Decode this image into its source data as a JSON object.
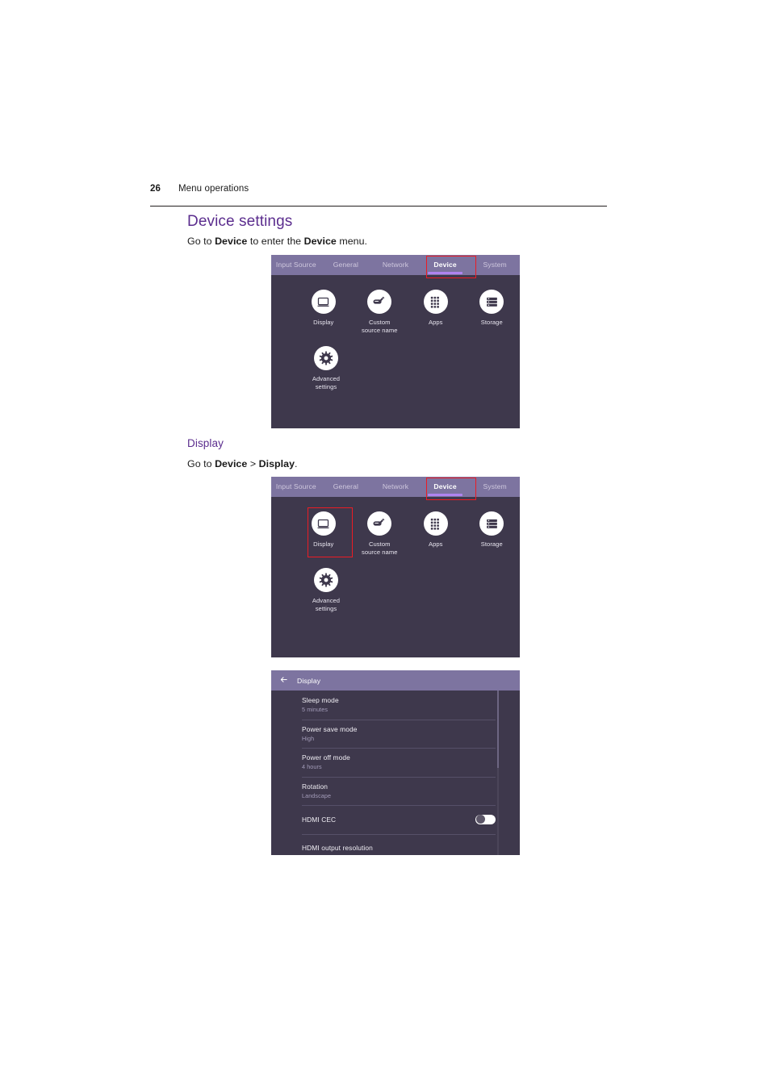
{
  "page": {
    "number": "26",
    "running_head": "Menu operations"
  },
  "section": {
    "heading": "Device settings",
    "intro_prefix": "Go to ",
    "intro_bold1": "Device",
    "intro_middle": " to enter the ",
    "intro_bold2": "Device",
    "intro_suffix": " menu."
  },
  "subsection": {
    "heading": "Display",
    "intro_prefix": "Go to ",
    "intro_bold1": "Device",
    "intro_middle": " > ",
    "intro_bold2": "Display",
    "intro_suffix": "."
  },
  "osd": {
    "tabs": [
      {
        "label": "Input Source",
        "active": false
      },
      {
        "label": "General",
        "active": false
      },
      {
        "label": "Network",
        "active": false
      },
      {
        "label": "Device",
        "active": true
      },
      {
        "label": "System",
        "active": false
      }
    ],
    "icons_row1": [
      {
        "label": "Display",
        "icon": "monitor-icon"
      },
      {
        "label": "Custom\nsource name",
        "icon": "rename-pencil-icon"
      },
      {
        "label": "Apps",
        "icon": "apps-grid-icon"
      },
      {
        "label": "Storage",
        "icon": "storage-list-icon"
      }
    ],
    "icons_row2": [
      {
        "label": "Advanced\nsettings",
        "icon": "gear-icon"
      }
    ]
  },
  "display_panel": {
    "back_icon": "back-arrow-icon",
    "title": "Display",
    "rows": [
      {
        "title": "Sleep mode",
        "sub": "5 minutes",
        "control": "none"
      },
      {
        "title": "Power save mode",
        "sub": "High",
        "control": "none"
      },
      {
        "title": "Power off mode",
        "sub": "4 hours",
        "control": "none"
      },
      {
        "title": "Rotation",
        "sub": "Landscape",
        "control": "none"
      },
      {
        "title": "HDMI CEC",
        "sub": "",
        "control": "toggle",
        "toggle_on": false
      },
      {
        "title": "HDMI output resolution",
        "sub": "",
        "control": "none"
      }
    ]
  },
  "colors": {
    "heading_purple": "#5B2D8E",
    "osd_tabbar": "#7D74A0",
    "osd_body": "#3E384C",
    "tab_underline": "#B084F0",
    "callout_red": "#EC1C24"
  }
}
